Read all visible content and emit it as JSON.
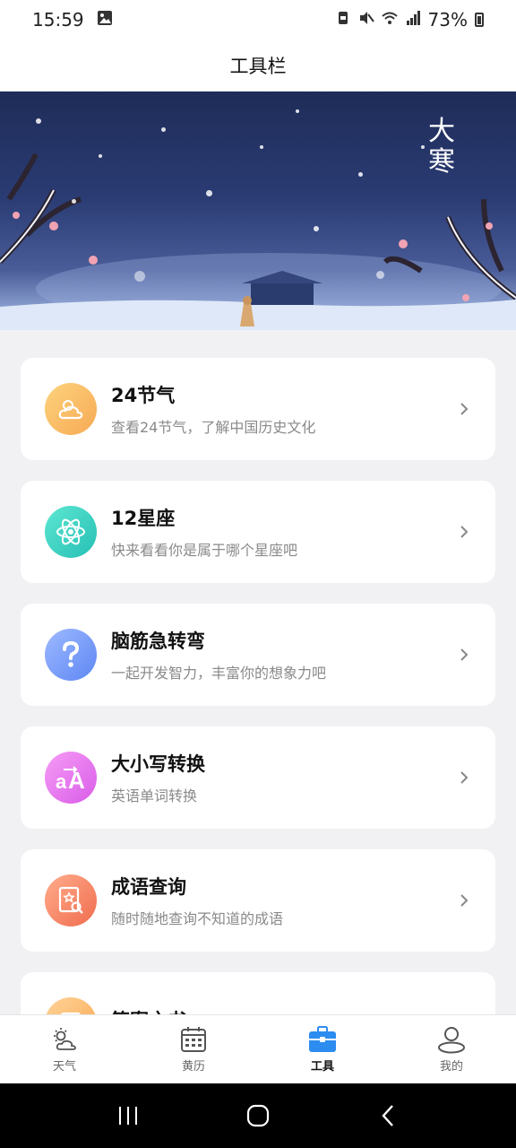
{
  "status_bar": {
    "time": "15:59",
    "battery": "73%"
  },
  "header": {
    "title": "工具栏"
  },
  "banner": {
    "text": "大寒"
  },
  "tools": [
    {
      "title": "24节气",
      "desc": "查看24节气，了解中国历史文化",
      "icon": "weather-cloud-icon",
      "color_from": "#fdd37d",
      "color_to": "#f7a954"
    },
    {
      "title": "12星座",
      "desc": "快来看看你是属于哪个星座吧",
      "icon": "atom-icon",
      "color_from": "#5ee7d2",
      "color_to": "#26bfb5"
    },
    {
      "title": "脑筋急转弯",
      "desc": "一起开发智力，丰富你的想象力吧",
      "icon": "question-icon",
      "color_from": "#9db9ff",
      "color_to": "#5e87f4"
    },
    {
      "title": "大小写转换",
      "desc": "英语单词转换",
      "icon": "case-convert-icon",
      "color_from": "#f69cf5",
      "color_to": "#d95ce8"
    },
    {
      "title": "成语查询",
      "desc": "随时随地查询不知道的成语",
      "icon": "book-search-icon",
      "color_from": "#ffad8c",
      "color_to": "#f06c4e"
    },
    {
      "title": "答案之书",
      "desc": "",
      "icon": "answer-book-icon",
      "color_from": "#ffd39a",
      "color_to": "#f8a94f"
    }
  ],
  "bottom_nav": [
    {
      "label": "天气",
      "icon": "weather-icon",
      "active": false
    },
    {
      "label": "黄历",
      "icon": "calendar-icon",
      "active": false
    },
    {
      "label": "工具",
      "icon": "toolbox-icon",
      "active": true
    },
    {
      "label": "我的",
      "icon": "profile-icon",
      "active": false
    }
  ],
  "colors": {
    "accent": "#2d8cf0",
    "background": "#f1f1f4"
  }
}
